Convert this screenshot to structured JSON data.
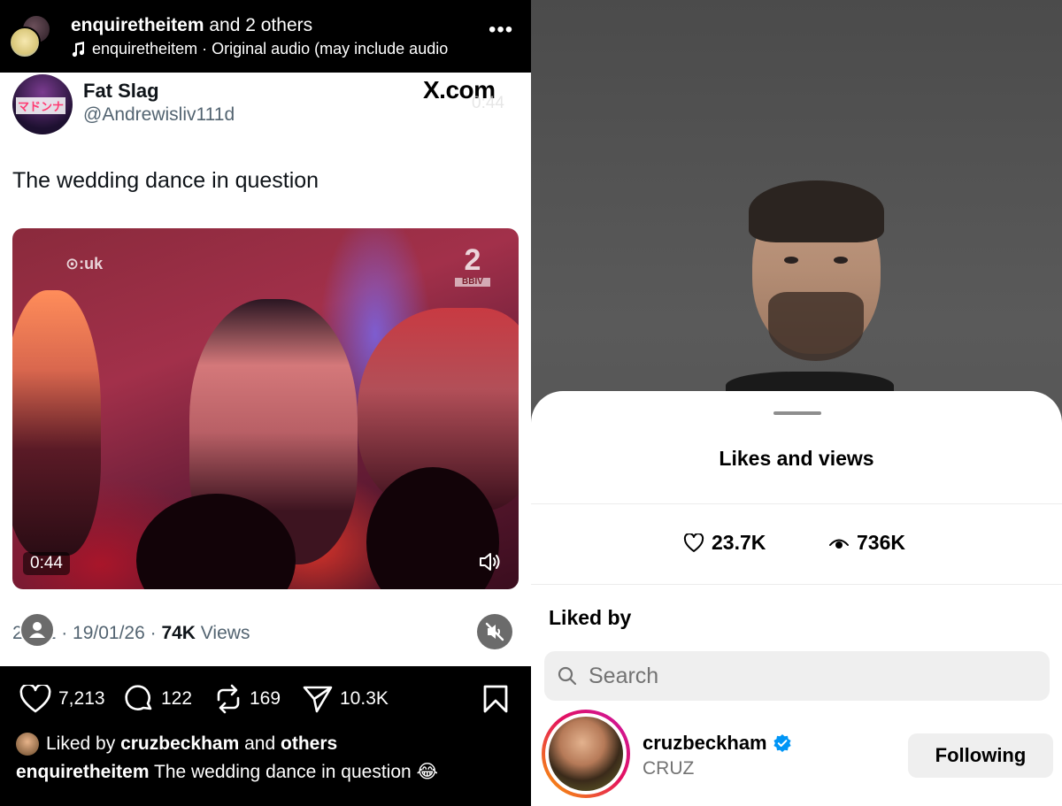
{
  "colors": {
    "ig_black": "#000000",
    "tweet_white": "#ffffff",
    "handle_gray": "#536471",
    "verified_blue": "#0095f6",
    "story_ring": [
      "#f9a400",
      "#e4115e",
      "#c917a5"
    ],
    "sheet_gray": "#efefef"
  },
  "reel": {
    "header": {
      "title_user": "enquiretheitem",
      "title_rest": " and 2 others",
      "audio_icon": "music-note-icon",
      "audio_text": "enquiretheitem · Original audio  (may include audio",
      "more_icon": "more-horizontal-icon",
      "more_label": "•••"
    },
    "tweet": {
      "name": "Fat Slag",
      "handle": "@Andrewisliv111d",
      "avatar_text": "マドンナ",
      "brand": "X.com",
      "ghost_time": "0:44",
      "text": "The wedding dance in question",
      "video": {
        "channel_logo": "⊙:uk",
        "badge_num": "2",
        "badge_small": "BBIV",
        "duration": "0:44",
        "sound_icon": "speaker-icon"
      },
      "meta_prefix": "2",
      "meta_mid": "1 · 19/01/26 · ",
      "meta_views_count": "74K",
      "meta_views_label": " Views"
    },
    "actions": {
      "likes": "7,213",
      "comments": "122",
      "reposts": "169",
      "shares": "10.3K"
    },
    "liked_by": {
      "prefix": "Liked by ",
      "user": "cruzbeckham",
      "middle": " and ",
      "suffix": "others"
    },
    "caption": {
      "user": "enquiretheitem",
      "text": " The wedding dance in question 😂"
    }
  },
  "sheet": {
    "title": "Likes and views",
    "likes": "23.7K",
    "views": "736K",
    "liked_by_heading": "Liked by",
    "search_placeholder": "Search",
    "users": [
      {
        "username": "cruzbeckham",
        "full_name": "CRUZ",
        "verified": true,
        "button": "Following"
      }
    ]
  }
}
